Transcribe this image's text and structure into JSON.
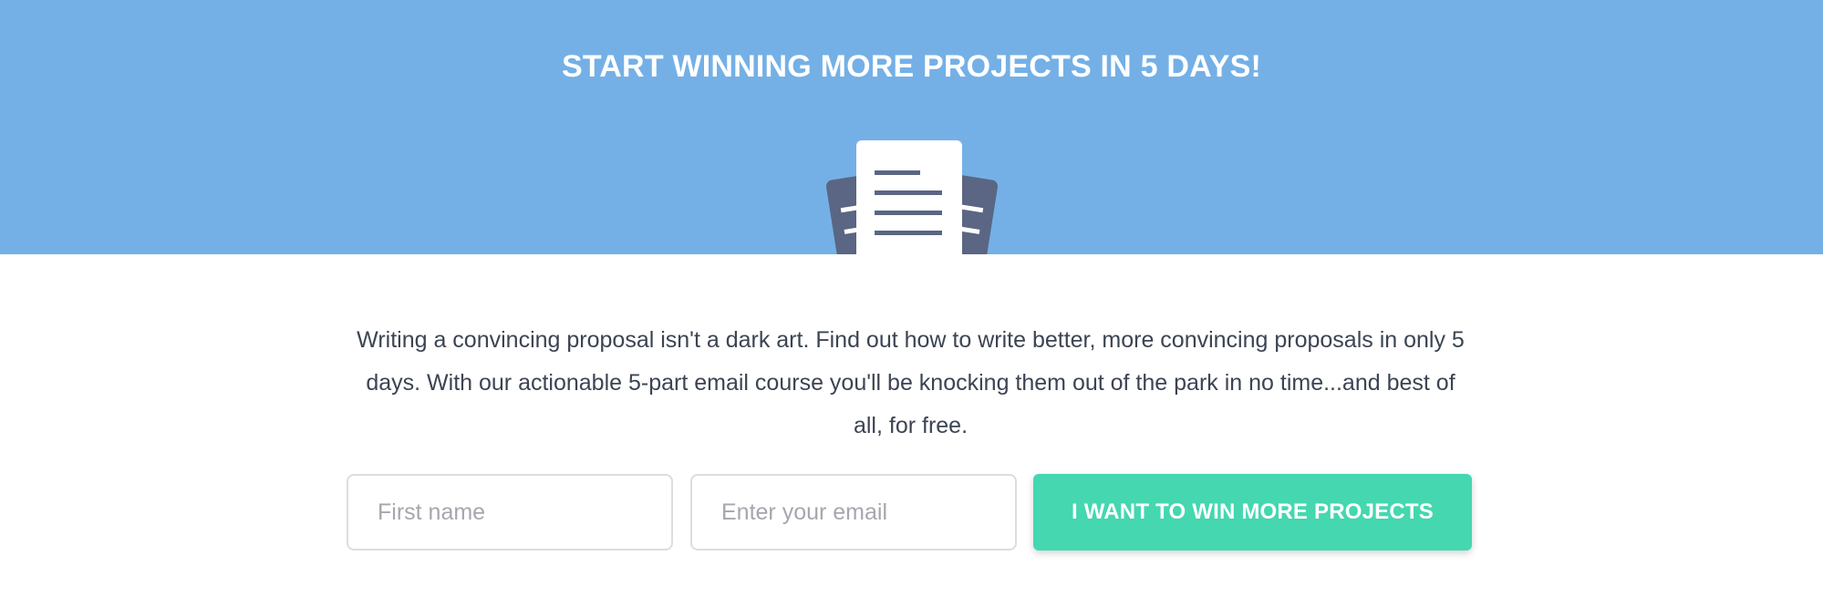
{
  "hero": {
    "title": "START WINNING MORE PROJECTS IN 5 DAYS!",
    "background_color": "#74b0e6",
    "illustration_icon": "document-stack-icon"
  },
  "content": {
    "description": "Writing a convincing proposal isn't a dark art. Find out how to write better, more convincing proposals in only 5 days. With our actionable 5-part email course you'll be knocking them out of the park in no time...and best of all, for free."
  },
  "form": {
    "first_name_placeholder": "First name",
    "first_name_value": "",
    "email_placeholder": "Enter your email",
    "email_value": "",
    "submit_label": "I WANT TO WIN MORE PROJECTS",
    "submit_color": "#44d7b0"
  }
}
